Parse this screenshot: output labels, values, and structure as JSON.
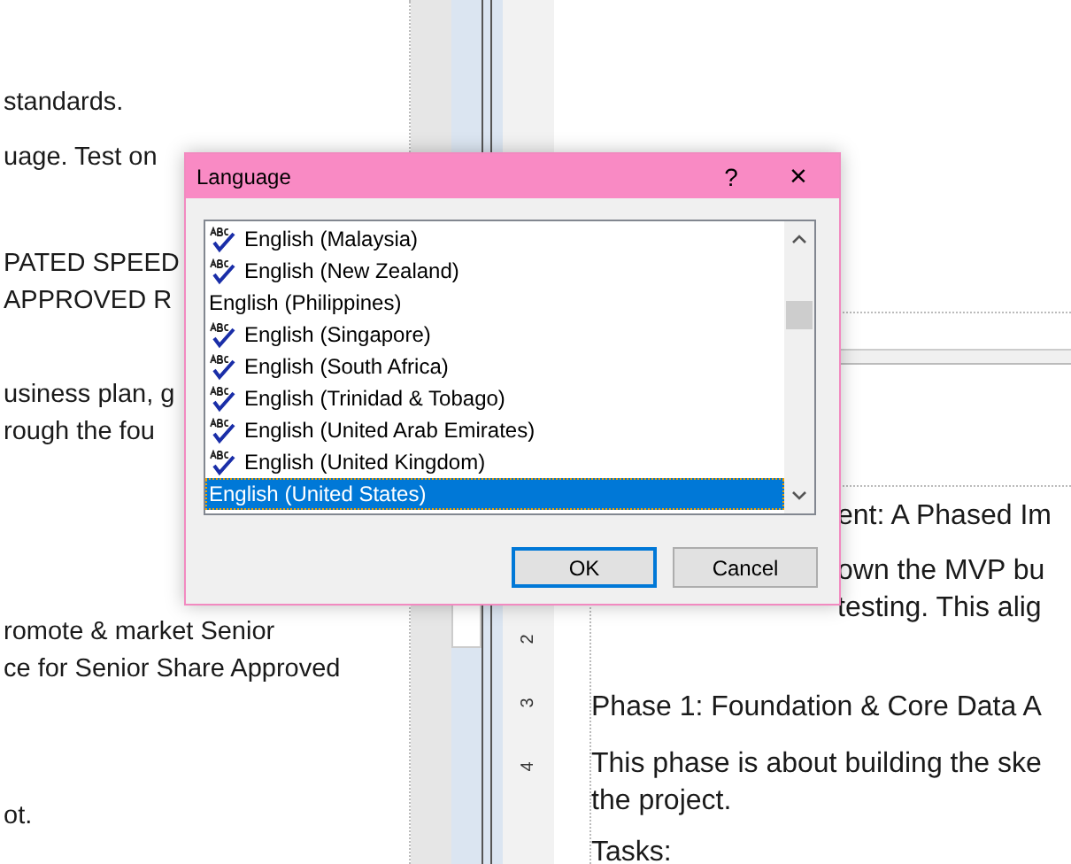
{
  "document": {
    "left_page": [
      {
        "lines": [
          "standards."
        ]
      },
      {
        "lines": [
          "uage. Test on"
        ]
      },
      {
        "lines": [
          "PATED SPEED",
          "APPROVED R"
        ]
      },
      {
        "lines": [
          "usiness plan, g",
          "rough the fou"
        ]
      },
      {
        "lines": [
          "romote & market Senior",
          "ce for Senior Share Approved"
        ]
      },
      {
        "lines": [
          "ot."
        ]
      }
    ],
    "ruler_numbers": [
      "2",
      "3",
      "4"
    ],
    "right_page": [
      {
        "lines": [
          "ent: A Phased Im"
        ]
      },
      {
        "lines": [
          "own the MVP bu",
          "testing. This alig"
        ]
      },
      {
        "lines": [
          "Phase 1: Foundation & Core Data A"
        ]
      },
      {
        "lines": [
          "This phase is about building the ske",
          "the project."
        ]
      },
      {
        "lines": [
          "Tasks:"
        ]
      }
    ]
  },
  "dialog": {
    "title": "Language",
    "help": "?",
    "close": "×",
    "languages": [
      {
        "label": "English (Malaysia)",
        "spellcheck": true,
        "selected": false
      },
      {
        "label": "English (New Zealand)",
        "spellcheck": true,
        "selected": false
      },
      {
        "label": "English (Philippines)",
        "spellcheck": false,
        "selected": false
      },
      {
        "label": "English (Singapore)",
        "spellcheck": true,
        "selected": false
      },
      {
        "label": "English (South Africa)",
        "spellcheck": true,
        "selected": false
      },
      {
        "label": "English (Trinidad & Tobago)",
        "spellcheck": true,
        "selected": false
      },
      {
        "label": "English (United Arab Emirates)",
        "spellcheck": true,
        "selected": false
      },
      {
        "label": "English (United Kingdom)",
        "spellcheck": true,
        "selected": false
      },
      {
        "label": "English (United States)",
        "spellcheck": false,
        "selected": true
      }
    ],
    "buttons": [
      {
        "label": "OK",
        "default": true
      },
      {
        "label": "Cancel",
        "default": false
      }
    ]
  }
}
